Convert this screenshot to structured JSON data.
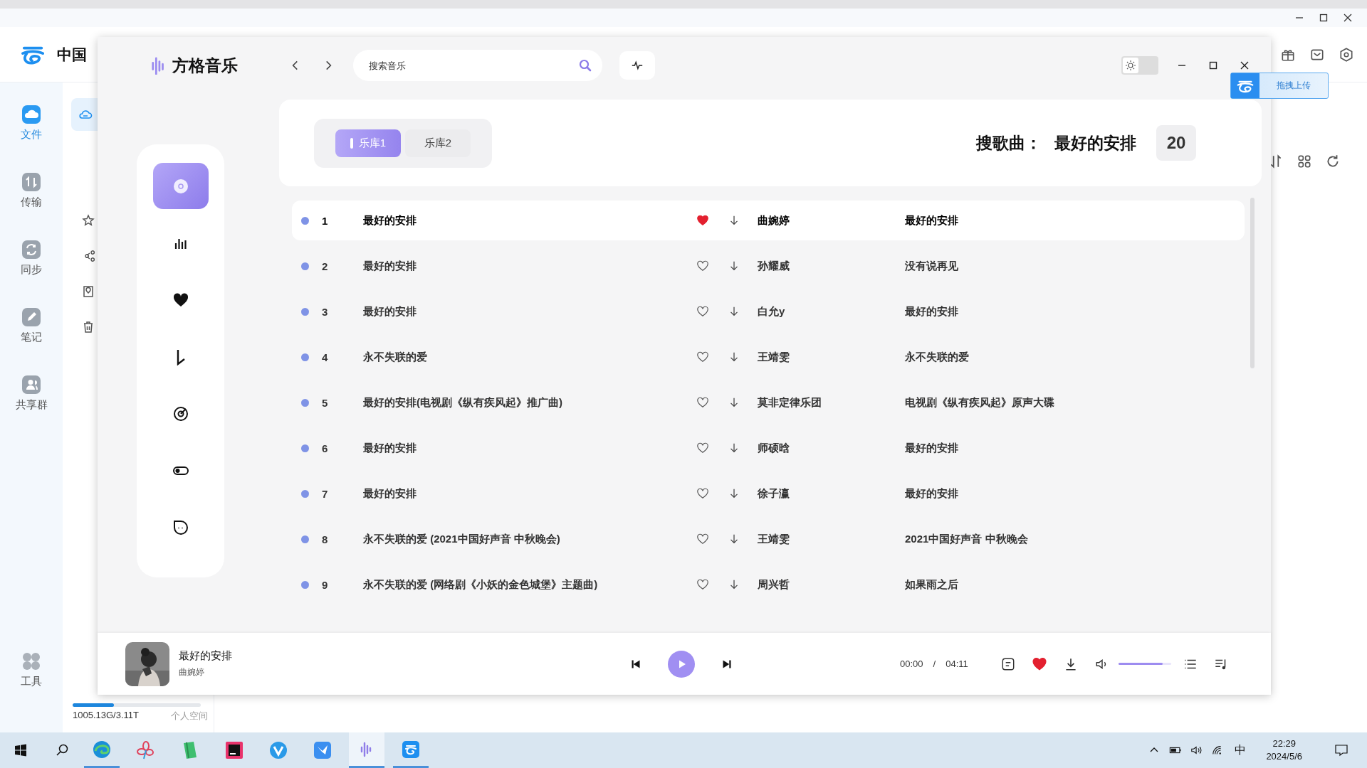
{
  "cloud_app": {
    "brand": "中国",
    "nav": [
      {
        "label": "文件",
        "selected": true
      },
      {
        "label": "传输",
        "selected": false
      },
      {
        "label": "同步",
        "selected": false
      },
      {
        "label": "笔记",
        "selected": false
      },
      {
        "label": "共享群",
        "selected": false
      }
    ],
    "tools": {
      "label": "工具"
    },
    "side_items": [
      {
        "selected": true
      },
      {
        "selected": false
      },
      {
        "selected": false
      },
      {
        "selected": false
      },
      {
        "selected": false
      }
    ],
    "storage": {
      "usage": "1005.13G/3.11T",
      "level": 0.32,
      "label": "个人空间"
    },
    "upload_button": "拖拽上传"
  },
  "music_app": {
    "title": "方格音乐",
    "search": {
      "placeholder": "搜索音乐"
    },
    "theme_toggle": {
      "on": false
    },
    "nav_items": [
      {
        "selected": true
      },
      {
        "selected": false
      },
      {
        "selected": false
      },
      {
        "selected": false
      },
      {
        "selected": false
      },
      {
        "selected": false
      },
      {
        "selected": false
      }
    ],
    "tabs": [
      {
        "label": "乐库1",
        "selected": true
      },
      {
        "label": "乐库2",
        "selected": false
      }
    ],
    "result": {
      "label": "搜歌曲：",
      "query": "最好的安排",
      "count": "20"
    },
    "songs": [
      {
        "index": "1",
        "title": "最好的安排",
        "liked": true,
        "artist": "曲婉婷",
        "album": "最好的安排",
        "selected": true
      },
      {
        "index": "2",
        "title": "最好的安排",
        "liked": false,
        "artist": "孙耀威",
        "album": "没有说再见",
        "selected": false
      },
      {
        "index": "3",
        "title": "最好的安排",
        "liked": false,
        "artist": "白允y",
        "album": "最好的安排",
        "selected": false
      },
      {
        "index": "4",
        "title": "永不失联的爱",
        "liked": false,
        "artist": "王靖雯",
        "album": "永不失联的爱",
        "selected": false
      },
      {
        "index": "5",
        "title": "最好的安排(电视剧《纵有疾风起》推广曲)",
        "liked": false,
        "artist": "莫非定律乐团",
        "album": "电视剧《纵有疾风起》原声大碟",
        "selected": false
      },
      {
        "index": "6",
        "title": "最好的安排",
        "liked": false,
        "artist": "师硕晗",
        "album": "最好的安排",
        "selected": false
      },
      {
        "index": "7",
        "title": "最好的安排",
        "liked": false,
        "artist": "徐子瀛",
        "album": "最好的安排",
        "selected": false
      },
      {
        "index": "8",
        "title": "永不失联的爱 (2021中国好声音 中秋晚会)",
        "liked": false,
        "artist": "王靖雯",
        "album": "2021中国好声音 中秋晚会",
        "selected": false
      },
      {
        "index": "9",
        "title": "永不失联的爱 (网络剧《小妖的金色城堡》主题曲)",
        "liked": false,
        "artist": "周兴哲",
        "album": "如果雨之后",
        "selected": false
      }
    ],
    "player": {
      "title": "最好的安排",
      "artist": "曲婉婷",
      "current_time": "00:00",
      "separator": "/",
      "total_time": "04:11",
      "liked": true,
      "volume": {
        "level": 0.84
      }
    }
  },
  "taskbar": {
    "apps": [
      {
        "running": true,
        "selected": false
      },
      {
        "running": false,
        "selected": false
      },
      {
        "running": false,
        "selected": false
      },
      {
        "running": false,
        "selected": false
      },
      {
        "running": false,
        "selected": false
      },
      {
        "running": false,
        "selected": false
      },
      {
        "running": true,
        "selected": true
      },
      {
        "running": true,
        "selected": false
      }
    ],
    "ime": "中",
    "time": "22:29",
    "date": "2024/5/6"
  }
}
